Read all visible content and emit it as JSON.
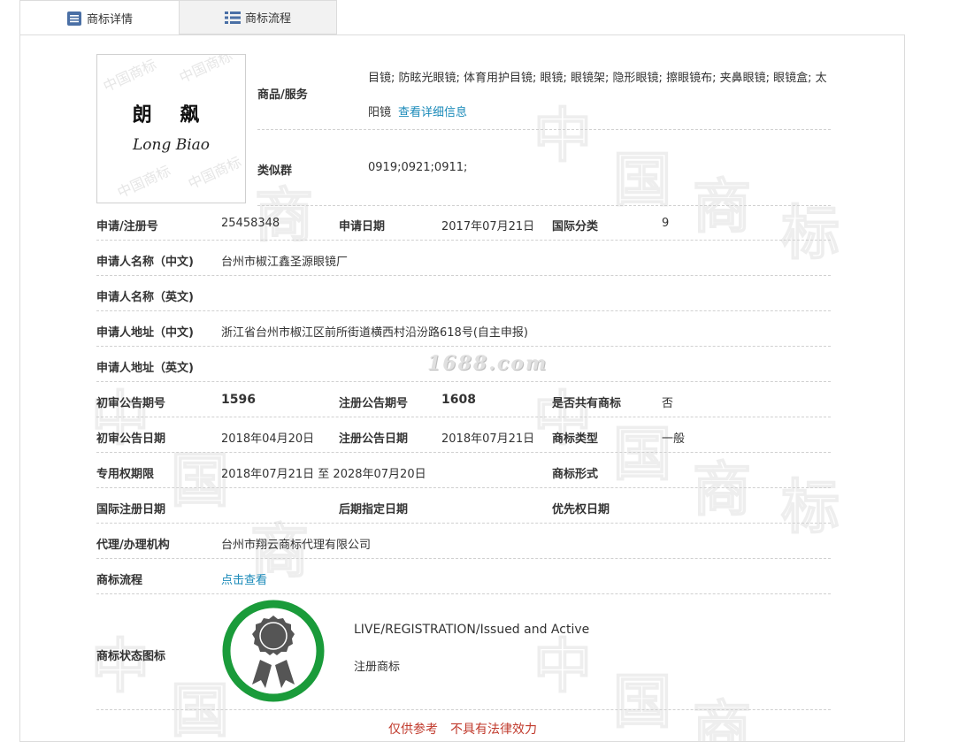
{
  "tabs": [
    {
      "label": "商标详情",
      "icon": "document-list-icon",
      "active": true
    },
    {
      "label": "商标流程",
      "icon": "grid-list-icon",
      "active": false
    }
  ],
  "logo": {
    "cn_text": "朗 飙",
    "en_text": "Long Biao"
  },
  "goods": {
    "label": "商品/服务",
    "value": "目镜; 防眩光眼镜; 体育用护目镜; 眼镜; 眼镜架; 隐形眼镜; 擦眼镜布; 夹鼻眼镜; 眼镜盒; 太阳镜",
    "link": "查看详细信息"
  },
  "similar_group": {
    "label": "类似群",
    "value": "0919;0921;0911;"
  },
  "rows": {
    "app_no": {
      "label": "申请/注册号",
      "value": "25458348"
    },
    "app_date": {
      "label": "申请日期",
      "value": "2017年07月21日"
    },
    "intl_class": {
      "label": "国际分类",
      "value": "9"
    },
    "applicant_cn": {
      "label": "申请人名称（中文)",
      "value": "台州市椒江鑫圣源眼镜厂"
    },
    "applicant_en": {
      "label": "申请人名称（英文)",
      "value": ""
    },
    "address_cn": {
      "label": "申请人地址（中文)",
      "value": "浙江省台州市椒江区前所街道横西村沿汾路618号(自主申报)"
    },
    "address_en": {
      "label": "申请人地址（英文)",
      "value": ""
    },
    "prelim_issue": {
      "label": "初审公告期号",
      "value": "1596"
    },
    "reg_issue": {
      "label": "注册公告期号",
      "value": "1608"
    },
    "shared": {
      "label": "是否共有商标",
      "value": "否"
    },
    "prelim_date": {
      "label": "初审公告日期",
      "value": "2018年04月20日"
    },
    "reg_date": {
      "label": "注册公告日期",
      "value": "2018年07月21日"
    },
    "mark_type": {
      "label": "商标类型",
      "value": "一般"
    },
    "exclusive": {
      "label": "专用权期限",
      "value": "2018年07月21日 至 2028年07月20日"
    },
    "mark_form": {
      "label": "商标形式",
      "value": ""
    },
    "intl_reg_date": {
      "label": "国际注册日期",
      "value": ""
    },
    "later_date": {
      "label": "后期指定日期",
      "value": ""
    },
    "priority_date": {
      "label": "优先权日期",
      "value": ""
    },
    "agency": {
      "label": "代理/办理机构",
      "value": "台州市翔云商标代理有限公司"
    },
    "flow": {
      "label": "商标流程",
      "link": "点击查看"
    },
    "status": {
      "label": "商标状态图标",
      "en": "LIVE/REGISTRATION/Issued and Active",
      "cn": "注册商标"
    }
  },
  "notice": {
    "part1": "仅供参考",
    "part2": "不具有法律效力"
  },
  "colors": {
    "link": "#1a8ab9",
    "seal_ring": "#1a9b3a",
    "seal_badge": "#555555",
    "notice": "#c0392b"
  }
}
